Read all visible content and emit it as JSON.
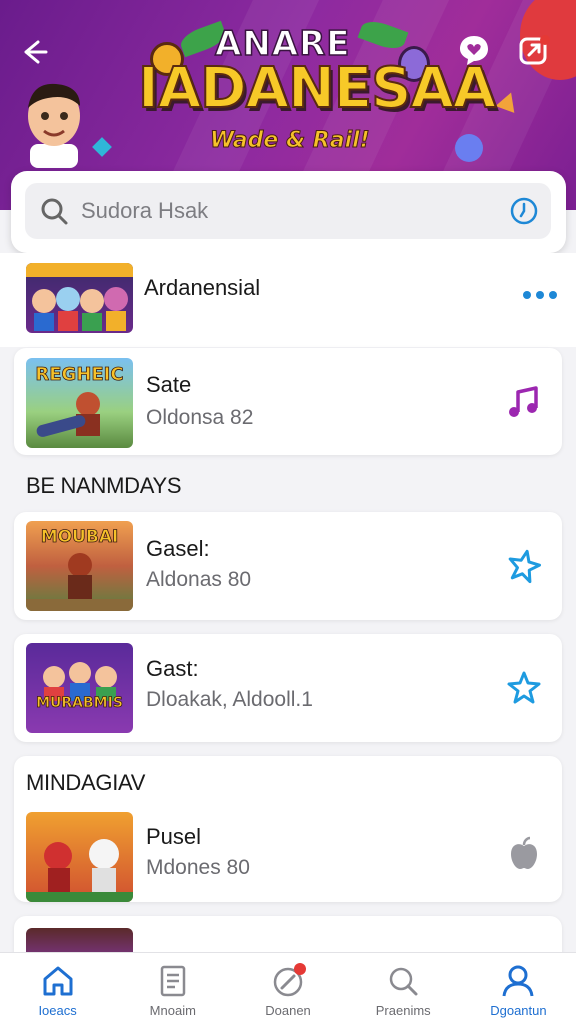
{
  "header": {
    "logo_top": "ANARE",
    "logo_main": "IADANESAA",
    "logo_sub": "Wade & Rail!",
    "back_icon": "back-arrow-icon",
    "heart_icon": "heart-chat-icon",
    "profile_icon": "share-icon"
  },
  "search": {
    "placeholder": "Sudora Hsak",
    "search_icon": "search-icon",
    "history_icon": "clock-icon"
  },
  "items": [
    {
      "title": "Ardanensial",
      "subtitle": "",
      "thumb_label": "",
      "action_icon": "more-dots-icon"
    },
    {
      "title": "Sate",
      "subtitle": "Oldonsa 82",
      "thumb_label": "REGHEIC",
      "action_icon": "music-note-icon"
    }
  ],
  "section1": {
    "title": "BE NANMDAYS"
  },
  "section1_items": [
    {
      "title": "Gasel:",
      "subtitle": "Aldonas 80",
      "thumb_label": "MOUBAI",
      "action_icon": "star-outline-icon"
    },
    {
      "title": "Gast:",
      "subtitle": "Dloakak, Aldooll.1",
      "thumb_label": "MURABMIS",
      "action_icon": "star-icon"
    }
  ],
  "section2": {
    "title": "MINDAGIAV"
  },
  "section2_items": [
    {
      "title": "Pusel",
      "subtitle": "Mdones 80",
      "thumb_label": "",
      "action_icon": "apple-icon"
    }
  ],
  "nav": [
    {
      "label": "Ioeacs",
      "icon": "home-icon",
      "active": true
    },
    {
      "label": "Mnoaim",
      "icon": "document-icon",
      "active": false
    },
    {
      "label": "Doanen",
      "icon": "pencil-icon",
      "active": false
    },
    {
      "label": "Praenims",
      "icon": "search-icon",
      "active": false
    },
    {
      "label": "Dgoantun",
      "icon": "profile-icon",
      "active": true
    }
  ],
  "colors": {
    "accent": "#1e6fd1",
    "banner": "#8d2aa0",
    "music": "#9c27b0",
    "star": "#1e9be0"
  }
}
